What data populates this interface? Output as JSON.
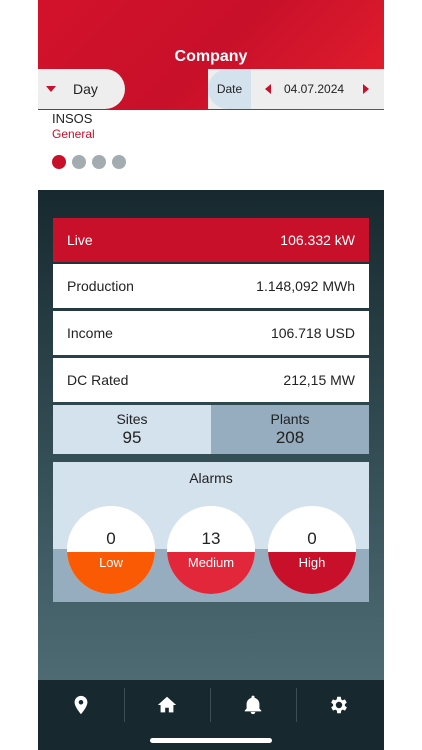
{
  "header": {
    "title": "Company"
  },
  "period": {
    "label": "Day"
  },
  "date": {
    "label": "Date",
    "value": "04.07.2024"
  },
  "site": {
    "name": "INSOS",
    "subtitle": "General"
  },
  "pager": {
    "total": 4,
    "active": 1
  },
  "metrics": {
    "live": {
      "label": "Live",
      "value": "106.332 kW"
    },
    "production": {
      "label": "Production",
      "value": "1.148,092 MWh"
    },
    "income": {
      "label": "Income",
      "value": "106.718 USD"
    },
    "dc_rated": {
      "label": "DC Rated",
      "value": "212,15 MW"
    }
  },
  "counts": {
    "sites": {
      "label": "Sites",
      "value": "95"
    },
    "plants": {
      "label": "Plants",
      "value": "208"
    }
  },
  "alarms": {
    "title": "Alarms",
    "low": {
      "label": "Low",
      "count": "0",
      "color": "#fb5a05"
    },
    "medium": {
      "label": "Medium",
      "count": "13",
      "color": "#e2273b"
    },
    "high": {
      "label": "High",
      "count": "0",
      "color": "#c8102a"
    }
  },
  "tabbar": {
    "items": [
      {
        "icon": "location-pin-icon"
      },
      {
        "icon": "home-icon"
      },
      {
        "icon": "bell-icon"
      },
      {
        "icon": "gear-icon"
      }
    ]
  },
  "colors": {
    "accent": "#c8102a",
    "light_blue": "#d4e2ee",
    "mid_blue": "#95adbe",
    "dark": "#17292f"
  }
}
